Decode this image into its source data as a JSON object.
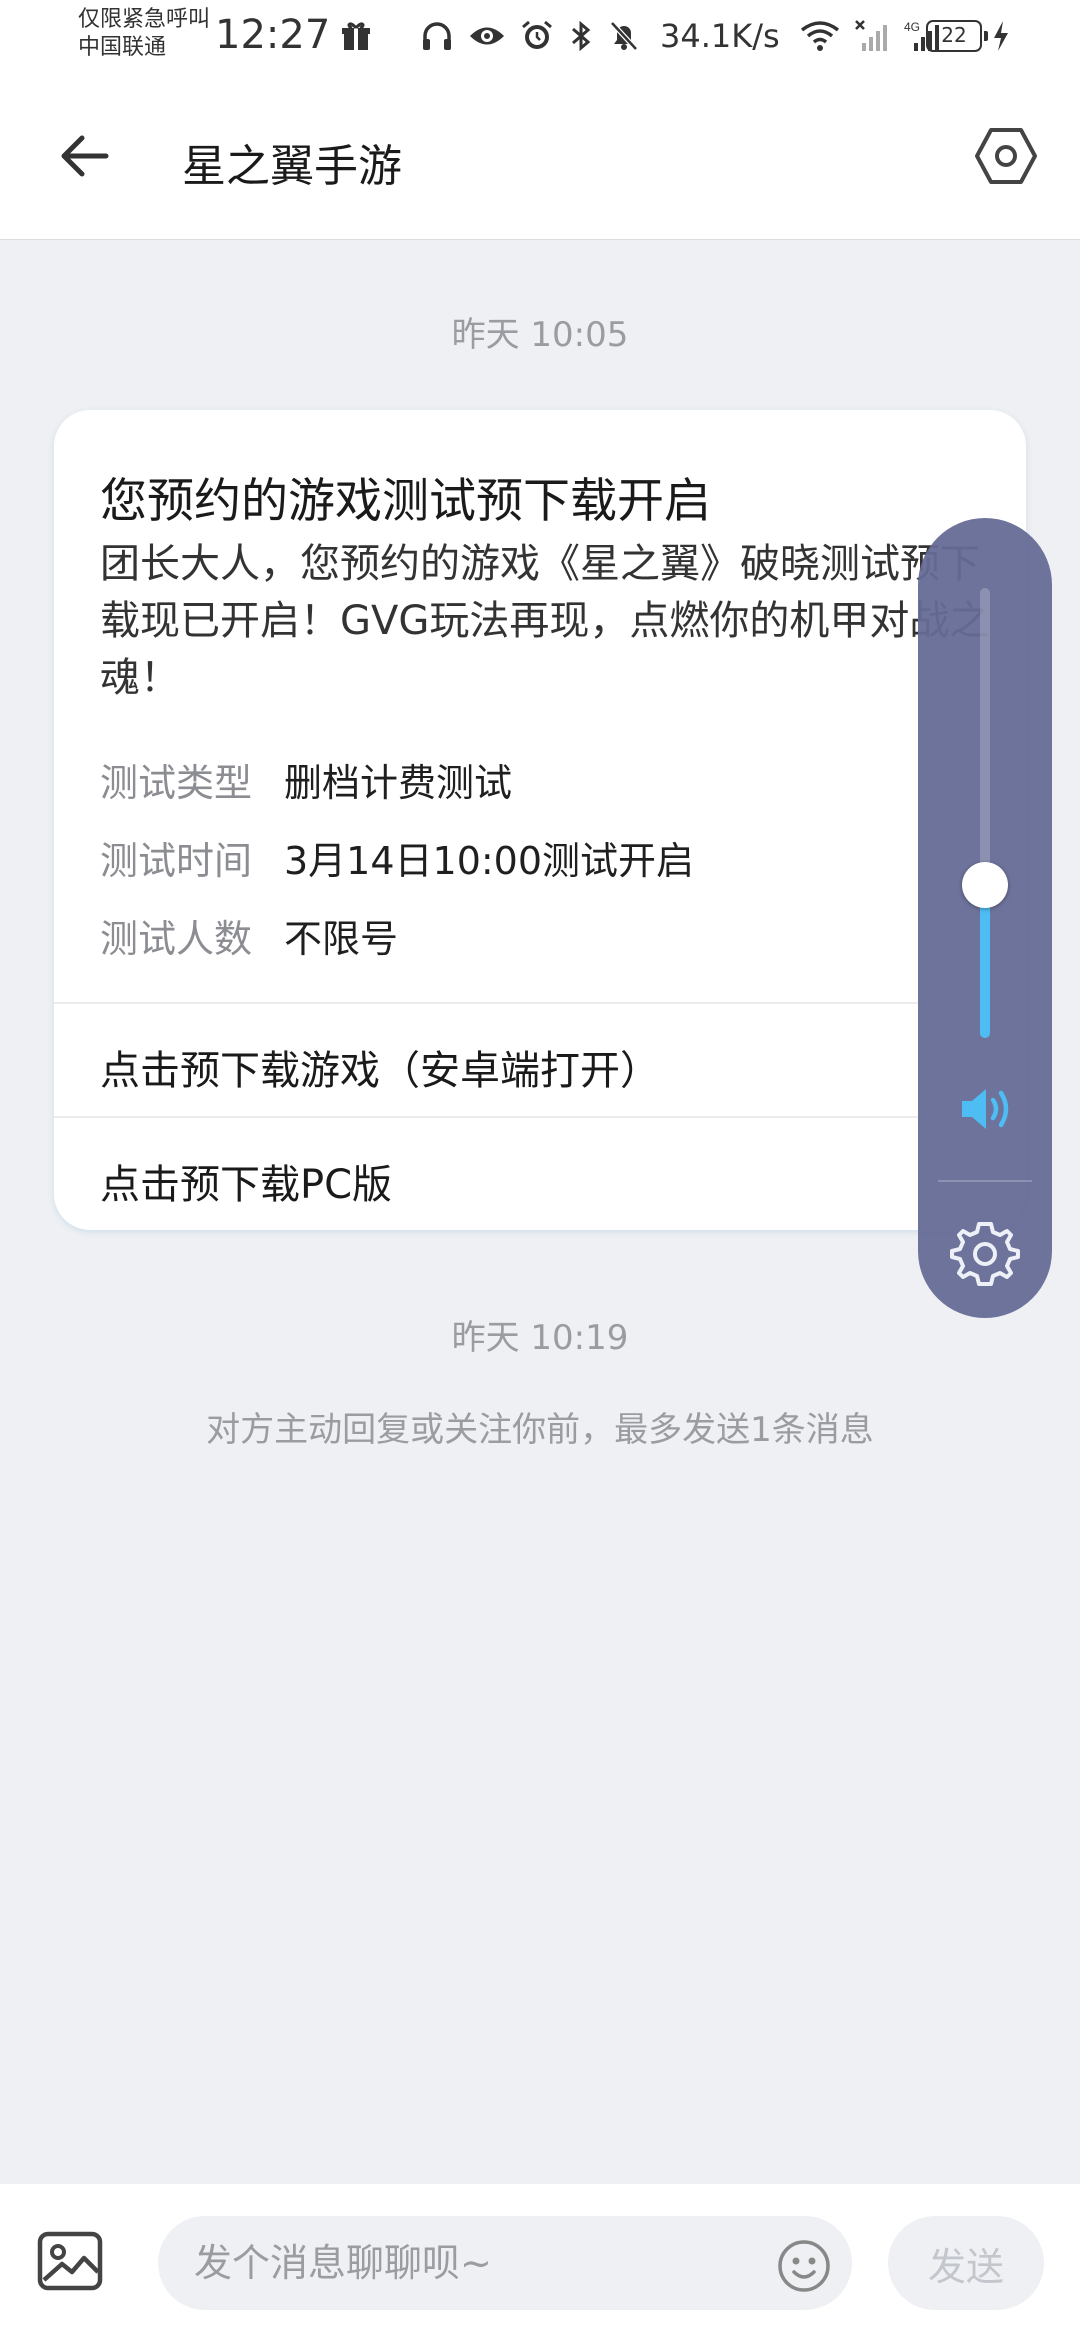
{
  "status_bar": {
    "carrier_line1": "仅限紧急呼叫",
    "carrier_line2": "中国联通",
    "time": "12:27",
    "net_speed": "34.1K/s",
    "battery": "22",
    "network_type": "4G"
  },
  "header": {
    "title": "星之翼手游"
  },
  "chat": {
    "timestamp1": "昨天 10:05",
    "card": {
      "title": "您预约的游戏测试预下载开启",
      "body": "团长大人，您预约的游戏《星之翼》破晓测试预下载现已开启！GVG玩法再现，点燃你的机甲对战之魂！",
      "rows": [
        {
          "label": "测试类型",
          "value": "删档计费测试"
        },
        {
          "label": "测试时间",
          "value": "3月14日10:00测试开启"
        },
        {
          "label": "测试人数",
          "value": "不限号"
        }
      ],
      "link_android": "点击预下载游戏（安卓端打开）",
      "link_pc": "点击预下载PC版"
    },
    "timestamp2": "昨天 10:19",
    "notice": "对方主动回复或关注你前，最多发送1条消息"
  },
  "volume": {
    "level": 0.34,
    "accent": "#4dbdf3"
  },
  "input_bar": {
    "placeholder": "发个消息聊聊呗~",
    "send_label": "发送"
  }
}
